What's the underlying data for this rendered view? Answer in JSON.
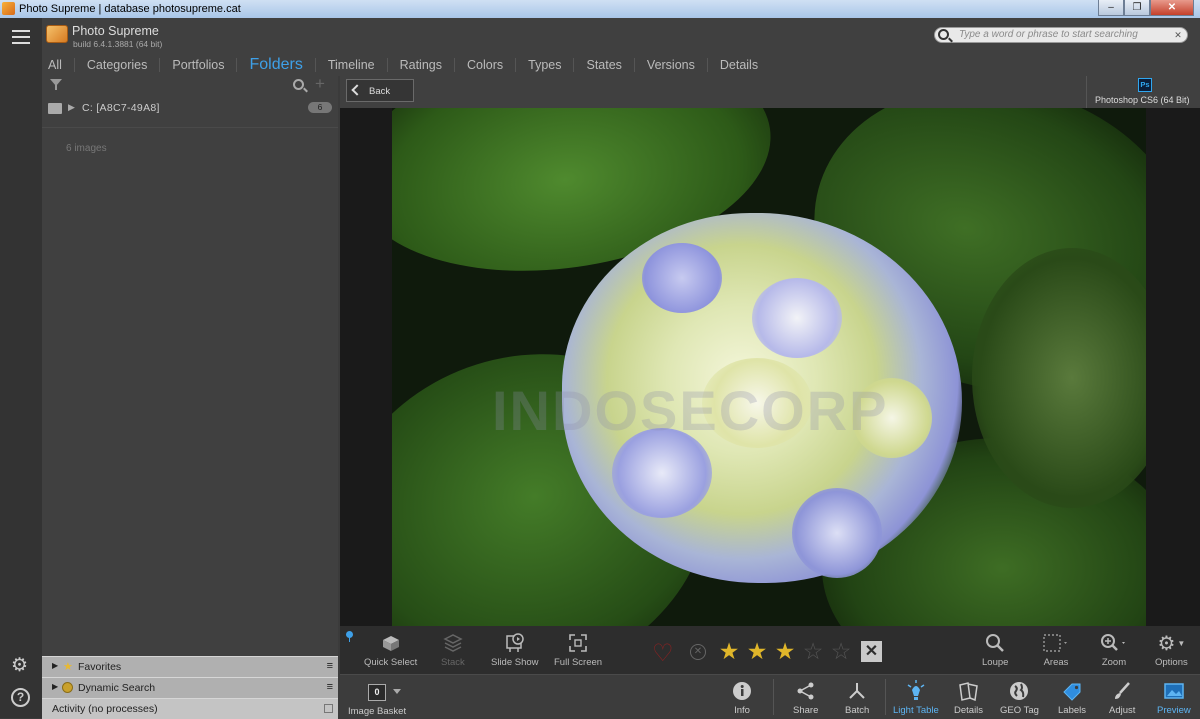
{
  "window": {
    "title": "Photo Supreme | database photosupreme.cat",
    "minimize": "–",
    "restore": "❐",
    "close": "✕"
  },
  "app": {
    "title": "Photo Supreme",
    "build": "build 6.4.1.3881 (64 bit)"
  },
  "search": {
    "placeholder": "Type a word or phrase to start searching",
    "clear": "✕"
  },
  "tabs": [
    "All",
    "Categories",
    "Portfolios",
    "Folders",
    "Timeline",
    "Ratings",
    "Colors",
    "Types",
    "States",
    "Versions",
    "Details"
  ],
  "active_tab": "Folders",
  "left_panel": {
    "folder": {
      "arrow": "▶",
      "name": "C:  [A8C7-49A8]",
      "count": "6"
    },
    "image_count": "6 images",
    "panes": [
      {
        "arrow": "▶",
        "label": "Favorites",
        "menu": "≡"
      },
      {
        "arrow": "▶",
        "label": "Dynamic Search",
        "menu": "≡"
      }
    ],
    "activity": "Activity (no processes)"
  },
  "viewer": {
    "back_label": "Back",
    "ext_editor_icon": "Ps",
    "ext_editor_label": "Photoshop CS6 (64 Bit)",
    "watermark": "INDOSECORP"
  },
  "image_toolbar": {
    "left": [
      {
        "label": "Quick Select",
        "icon": "quick-select-icon"
      },
      {
        "label": "Stack",
        "icon": "stack-icon"
      },
      {
        "label": "Slide Show",
        "icon": "slide-show-icon"
      },
      {
        "label": "Full Screen",
        "icon": "full-screen-icon"
      }
    ],
    "rating": 3,
    "max_rating": 5,
    "right": [
      {
        "label": "Loupe",
        "icon": "loupe-icon"
      },
      {
        "label": "Areas",
        "icon": "areas-icon"
      },
      {
        "label": "Zoom",
        "icon": "zoom-icon"
      },
      {
        "label": "Options",
        "icon": "options-icon"
      }
    ]
  },
  "bottom_bar": {
    "basket_count": "0",
    "basket_label": "Image Basket",
    "items": [
      {
        "label": "Info",
        "icon": "info-icon"
      },
      {
        "label": "Share",
        "icon": "share-icon"
      },
      {
        "label": "Batch",
        "icon": "batch-icon"
      },
      {
        "label": "Light Table",
        "icon": "light-table-icon"
      },
      {
        "label": "Details",
        "icon": "details-icon"
      },
      {
        "label": "GEO Tag",
        "icon": "geo-tag-icon"
      },
      {
        "label": "Labels",
        "icon": "labels-icon"
      },
      {
        "label": "Adjust",
        "icon": "adjust-icon"
      },
      {
        "label": "Preview",
        "icon": "preview-icon"
      }
    ]
  },
  "colors": {
    "accent": "#3ea0e8",
    "star": "#e0b62a",
    "heart": "#8a2222"
  }
}
